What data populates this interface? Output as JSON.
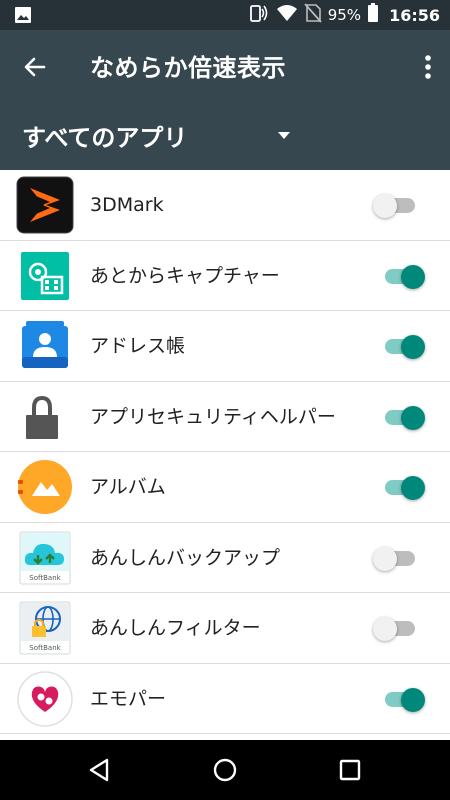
{
  "status_bar": {
    "battery": "95%",
    "time": "16:56",
    "icons": [
      "image-icon",
      "nfc-icon",
      "wifi-icon",
      "no-sim-icon",
      "battery-icon"
    ]
  },
  "app_bar": {
    "title": "なめらか倍速表示",
    "back_icon": "arrow-back-icon",
    "menu_icon": "more-vert-icon"
  },
  "filter": {
    "label": "すべてのアプリ"
  },
  "apps": [
    {
      "name": "3DMark",
      "enabled": false
    },
    {
      "name": "あとからキャプチャー",
      "enabled": true
    },
    {
      "name": "アドレス帳",
      "enabled": true
    },
    {
      "name": "アプリセキュリティヘルパー",
      "enabled": true
    },
    {
      "name": "アルバム",
      "enabled": true
    },
    {
      "name": "あんしんバックアップ",
      "enabled": false
    },
    {
      "name": "あんしんフィルター",
      "enabled": false
    },
    {
      "name": "エモパー",
      "enabled": true
    }
  ],
  "softbank_badge": "SoftBank",
  "colors": {
    "status_bar": "#263238",
    "app_bar": "#37474f",
    "switch_on": "#00897b",
    "switch_on_track": "#80cbc4"
  }
}
